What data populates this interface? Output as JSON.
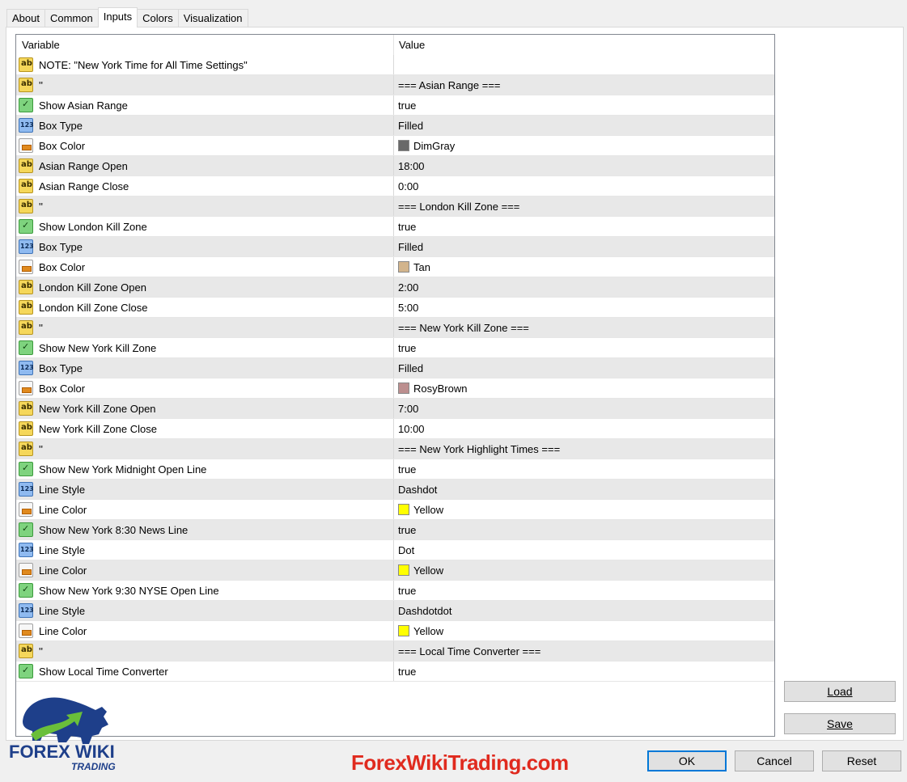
{
  "tabs": [
    "About",
    "Common",
    "Inputs",
    "Colors",
    "Visualization"
  ],
  "active_tab": "Inputs",
  "grid": {
    "col_variable": "Variable",
    "col_value": "Value",
    "rows": [
      {
        "icon": "string-icon",
        "variable": "NOTE: \"New York Time for All Time Settings\"",
        "value": ""
      },
      {
        "icon": "string-icon",
        "variable": "''",
        "value": "=== Asian Range ==="
      },
      {
        "icon": "bool-icon",
        "variable": "Show Asian Range",
        "value": "true"
      },
      {
        "icon": "enum-icon",
        "variable": "Box Type",
        "value": "Filled"
      },
      {
        "icon": "color-icon",
        "variable": "Box Color",
        "value": "DimGray",
        "swatch": "#696969"
      },
      {
        "icon": "string-icon",
        "variable": "Asian Range Open",
        "value": "18:00"
      },
      {
        "icon": "string-icon",
        "variable": "Asian Range Close",
        "value": "0:00"
      },
      {
        "icon": "string-icon",
        "variable": "''",
        "value": "=== London Kill Zone ==="
      },
      {
        "icon": "bool-icon",
        "variable": "Show London Kill Zone",
        "value": "true"
      },
      {
        "icon": "enum-icon",
        "variable": "Box Type",
        "value": "Filled"
      },
      {
        "icon": "color-icon",
        "variable": "Box Color",
        "value": "Tan",
        "swatch": "#d2b48c"
      },
      {
        "icon": "string-icon",
        "variable": "London Kill Zone Open",
        "value": "2:00"
      },
      {
        "icon": "string-icon",
        "variable": "London Kill Zone Close",
        "value": "5:00"
      },
      {
        "icon": "string-icon",
        "variable": "''",
        "value": "=== New York Kill Zone ==="
      },
      {
        "icon": "bool-icon",
        "variable": "Show New York Kill Zone",
        "value": "true"
      },
      {
        "icon": "enum-icon",
        "variable": "Box Type",
        "value": "Filled"
      },
      {
        "icon": "color-icon",
        "variable": "Box Color",
        "value": "RosyBrown",
        "swatch": "#bc8f8f"
      },
      {
        "icon": "string-icon",
        "variable": "New York Kill Zone Open",
        "value": "7:00"
      },
      {
        "icon": "string-icon",
        "variable": "New York Kill Zone Close",
        "value": "10:00"
      },
      {
        "icon": "string-icon",
        "variable": "''",
        "value": "=== New York Highlight Times ==="
      },
      {
        "icon": "bool-icon",
        "variable": "Show New York Midnight Open Line",
        "value": "true"
      },
      {
        "icon": "enum-icon",
        "variable": "Line Style",
        "value": "Dashdot"
      },
      {
        "icon": "color-icon",
        "variable": "Line Color",
        "value": "Yellow",
        "swatch": "#ffff00"
      },
      {
        "icon": "bool-icon",
        "variable": "Show New York 8:30 News Line",
        "value": "true"
      },
      {
        "icon": "enum-icon",
        "variable": "Line Style",
        "value": "Dot"
      },
      {
        "icon": "color-icon",
        "variable": "Line Color",
        "value": "Yellow",
        "swatch": "#ffff00"
      },
      {
        "icon": "bool-icon",
        "variable": "Show New York 9:30 NYSE Open Line",
        "value": "true"
      },
      {
        "icon": "enum-icon",
        "variable": "Line Style",
        "value": "Dashdotdot"
      },
      {
        "icon": "color-icon",
        "variable": "Line Color",
        "value": "Yellow",
        "swatch": "#ffff00"
      },
      {
        "icon": "string-icon",
        "variable": "''",
        "value": "=== Local Time Converter ==="
      },
      {
        "icon": "bool-icon",
        "variable": "Show Local Time Converter",
        "value": "true"
      }
    ]
  },
  "buttons": {
    "load": "Load",
    "save": "Save",
    "ok": "OK",
    "cancel": "Cancel",
    "reset": "Reset"
  },
  "watermark": {
    "logo_text": "FOREX WIKI",
    "logo_sub": "TRADING",
    "site": "ForexWikiTrading.com"
  },
  "colors": {
    "logo_blue": "#1e3f8a",
    "logo_green": "#6abf3a",
    "site_red": "#e02a1e"
  }
}
